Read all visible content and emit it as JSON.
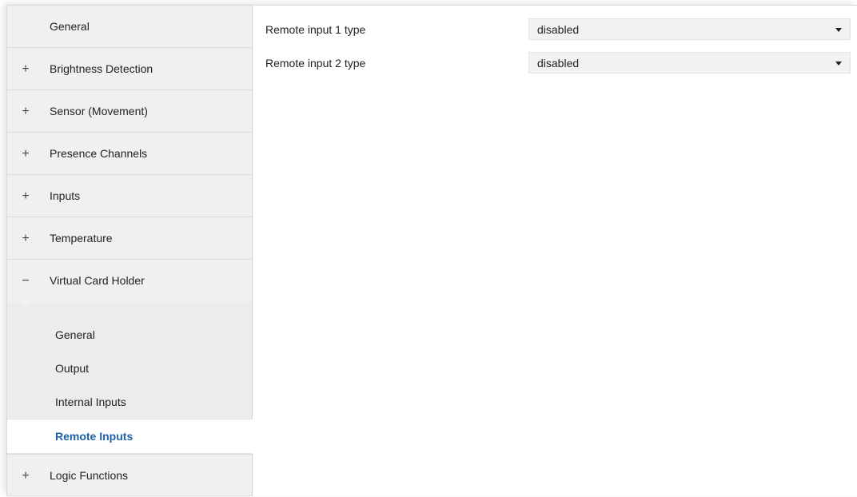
{
  "sidebar": {
    "items_top": [
      {
        "sign": "",
        "label": "General"
      },
      {
        "sign": "+",
        "label": "Brightness Detection"
      },
      {
        "sign": "+",
        "label": "Sensor (Movement)"
      },
      {
        "sign": "+",
        "label": "Presence Channels"
      },
      {
        "sign": "+",
        "label": "Inputs"
      },
      {
        "sign": "+",
        "label": "Temperature"
      },
      {
        "sign": "−",
        "label": "Virtual Card Holder"
      }
    ],
    "sub_items": [
      {
        "label": "General"
      },
      {
        "label": "Output"
      },
      {
        "label": "Internal Inputs"
      },
      {
        "label": "Remote Inputs"
      }
    ],
    "items_bottom": [
      {
        "sign": "+",
        "label": "Logic Functions"
      }
    ],
    "active_color": "#1f5fa8"
  },
  "params": [
    {
      "label": "Remote input 1 type",
      "value": "disabled"
    },
    {
      "label": "Remote input 2 type",
      "value": "disabled"
    }
  ]
}
